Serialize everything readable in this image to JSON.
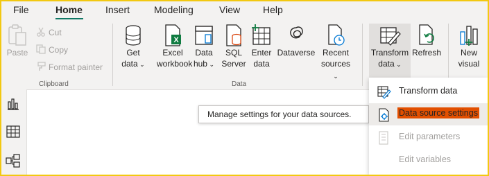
{
  "tabs": [
    "File",
    "Home",
    "Insert",
    "Modeling",
    "View",
    "Help"
  ],
  "active_tab": "Home",
  "clipboard": {
    "paste": "Paste",
    "cut": "Cut",
    "copy": "Copy",
    "format_painter": "Format painter",
    "group_label": "Clipboard"
  },
  "data_group": {
    "get_data": [
      "Get",
      "data"
    ],
    "excel": [
      "Excel",
      "workbook"
    ],
    "data_hub": [
      "Data",
      "hub"
    ],
    "sql": [
      "SQL",
      "Server"
    ],
    "enter": [
      "Enter",
      "data"
    ],
    "dataverse": "Dataverse",
    "recent": [
      "Recent",
      "sources"
    ],
    "group_label": "Data"
  },
  "queries": {
    "transform": [
      "Transform",
      "data"
    ],
    "refresh": "Refresh"
  },
  "insert": {
    "new_visual": [
      "New",
      "visual"
    ]
  },
  "tooltip": "Manage settings for your data sources.",
  "dropdown": {
    "items": [
      "Transform data",
      "Data source settings",
      "Edit parameters",
      "Edit variables"
    ]
  },
  "colors": {
    "accent": "#117865",
    "highlight": "#e24f00",
    "frame": "#f2c811"
  },
  "icons": [
    "paste-icon",
    "cut-icon",
    "copy-icon",
    "format-painter-icon",
    "database-icon",
    "excel-icon",
    "data-hub-icon",
    "sql-server-icon",
    "enter-data-icon",
    "dataverse-icon",
    "recent-sources-icon",
    "transform-data-icon",
    "refresh-icon",
    "new-visual-icon",
    "report-view-icon",
    "table-view-icon",
    "model-view-icon",
    "data-source-settings-icon",
    "edit-parameters-icon"
  ]
}
